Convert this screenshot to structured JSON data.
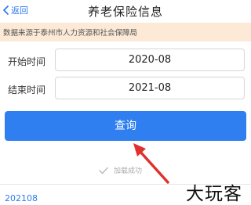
{
  "header": {
    "back_label": "返回",
    "title": "养老保险信息"
  },
  "notice": {
    "text": "数据来源于泰州市人力资源和社会保障局"
  },
  "form": {
    "start_label": "开始时间",
    "start_value": "2020-08",
    "end_label": "结束时间",
    "end_value": "2021-08"
  },
  "query_button_label": "查询",
  "status": {
    "loaded_text": "加载成功"
  },
  "records": {
    "first_month": "202108"
  },
  "watermark": "大玩客",
  "colors": {
    "accent": "#2f7ff0",
    "notice_bg": "#fce9d6",
    "arrow": "#e0312e"
  },
  "icons": {
    "back": "chevron-left-icon",
    "loaded": "check-icon"
  }
}
